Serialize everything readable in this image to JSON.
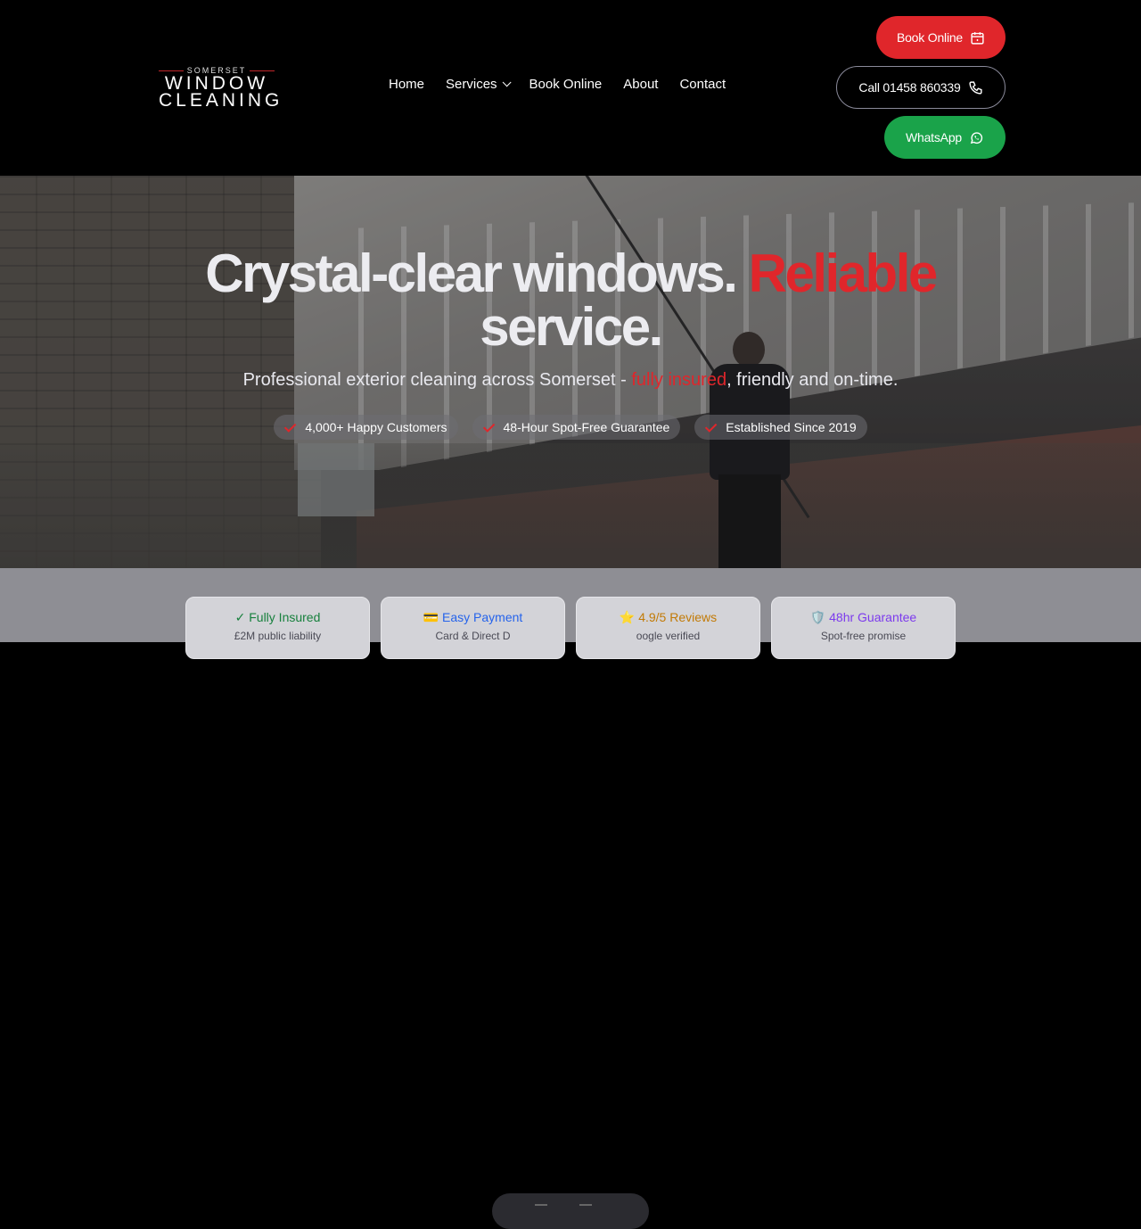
{
  "header": {
    "logo": {
      "top": "SOMERSET",
      "line1": "WINDOW",
      "line2": "CLEANING"
    },
    "nav": [
      {
        "label": "Home"
      },
      {
        "label": "Services"
      },
      {
        "label": "Book Online"
      },
      {
        "label": "About"
      },
      {
        "label": "Contact"
      }
    ],
    "buttons": {
      "book": "Book Online",
      "call": "Call 01458 860339",
      "whatsapp": "WhatsApp"
    }
  },
  "hero": {
    "title_part1": "Crystal-clear windows. ",
    "title_accent": "Reliable",
    "title_part2": "service.",
    "subtitle_part1": "Professional exterior cleaning across Somerset - ",
    "subtitle_accent": "fully insured",
    "subtitle_part2": ", friendly and on-time.",
    "badges": [
      {
        "label": "4,000+ Happy Customers"
      },
      {
        "label": "48-Hour Spot-Free Guarantee"
      },
      {
        "label": "Established Since 2019"
      }
    ]
  },
  "features": [
    {
      "icon": "✓",
      "title": "Fully Insured",
      "desc": "£2M public liability"
    },
    {
      "icon": "💳",
      "title": "Easy Payment",
      "desc": "Card & Direct D"
    },
    {
      "icon": "⭐",
      "title": "4.9/5 Reviews",
      "desc": "oogle verified"
    },
    {
      "icon": "🛡️",
      "title": "48hr Guarantee",
      "desc": "Spot-free promise"
    }
  ],
  "colors": {
    "accent": "#e0262b",
    "whatsapp": "#1aa34a",
    "header_bg": "#000000"
  }
}
